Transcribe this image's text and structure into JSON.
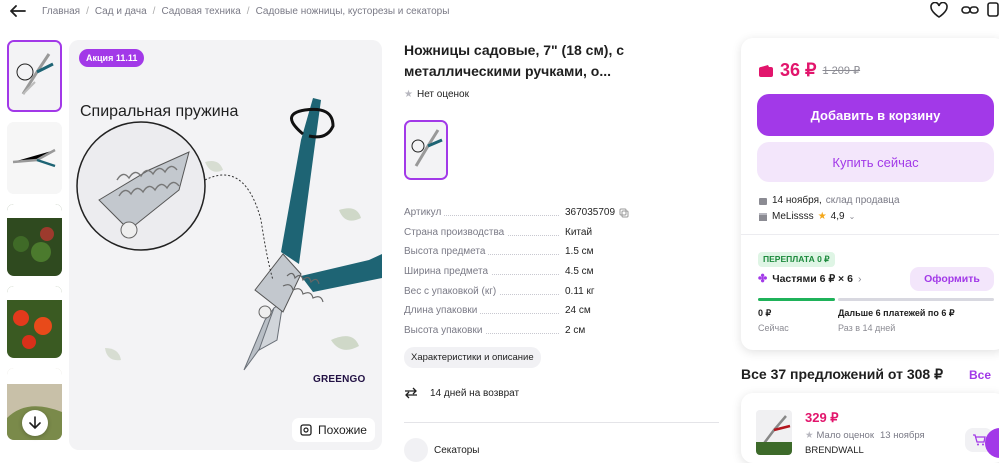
{
  "breadcrumb": {
    "items": [
      "Главная",
      "Сад и дача",
      "Садовая техника",
      "Садовые ножницы, кусторезы и секаторы"
    ],
    "separator": "/"
  },
  "gallery": {
    "promo_badge": "Акция 11.11",
    "headline": "Спиральная пружина",
    "brand_logo": "GREENGO",
    "similar_label": "Похожие"
  },
  "product": {
    "title_line1": "Ножницы садовые, 7\" (18 см), с",
    "title_line2": "металлическими ручками, о...",
    "rating_text": "Нет оценок",
    "specs": [
      {
        "key": "Артикул",
        "value": "367035709"
      },
      {
        "key": "Страна производства",
        "value": "Китай"
      },
      {
        "key": "Высота предмета",
        "value": "1.5 см"
      },
      {
        "key": "Ширина предмета",
        "value": "4.5 см"
      },
      {
        "key": "Вес с упаковкой (кг)",
        "value": "0.11 кг"
      },
      {
        "key": "Длина упаковки",
        "value": "24 см"
      },
      {
        "key": "Высота упаковки",
        "value": "2 см"
      }
    ],
    "chars_button": "Характеристики и описание",
    "returns_text": "14 дней на возврат",
    "category_text": "Секаторы"
  },
  "buy_card": {
    "price": "36 ₽",
    "old_price": "1 209 ₽",
    "add_to_cart": "Добавить в корзину",
    "buy_now": "Купить сейчас",
    "delivery_date": "14 ноября,",
    "delivery_source": "склад продавца",
    "seller_name": "MeLissss",
    "seller_rating": "4,9",
    "overpay_badge": "ПЕРЕПЛАТА 0 ₽",
    "parts_label": "Частями 6 ₽ × 6",
    "order_button": "Оформить",
    "pay_now_amount": "0 ₽",
    "pay_now_label": "Сейчас",
    "pay_later_amount": "Дальше 6 платежей по 6 ₽",
    "pay_later_label": "Раз в 14 дней"
  },
  "offers": {
    "title": "Все 37 предложений от 308 ₽",
    "all_link": "Все",
    "first_offer": {
      "price": "329 ₽",
      "rating": "Мало оценок",
      "date": "13 ноября",
      "seller": "BRENDWALL"
    }
  },
  "colors": {
    "accent": "#a239e8",
    "price": "#e2156c",
    "success": "#1fb25a"
  }
}
